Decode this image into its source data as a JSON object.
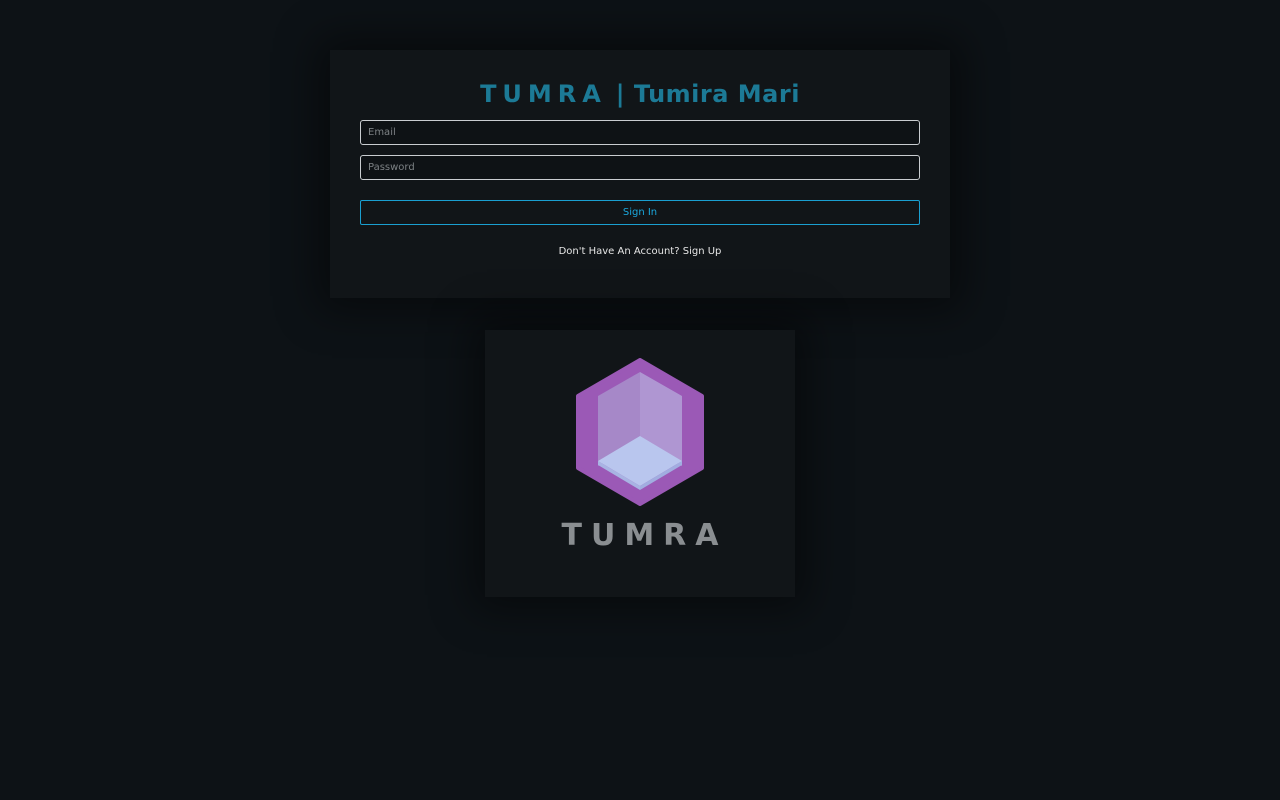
{
  "login": {
    "title_brand": "TUMRA",
    "title_separator": " | ",
    "title_name": "Tumira Mari",
    "email": {
      "placeholder": "Email",
      "value": ""
    },
    "password": {
      "placeholder": "Password",
      "value": ""
    },
    "signin_label": "Sign In",
    "signup_prompt": "Don't Have An Account?",
    "signup_link": "Sign Up"
  },
  "logo": {
    "text": "TUMRA",
    "icon": "hexagon-cube-icon",
    "colors": {
      "hex_outer": "#9b59b6",
      "cube_face": "#b8a6d8",
      "cube_floor": "#b4c4ec",
      "text": "#8a8e91"
    }
  },
  "colors": {
    "background": "#0d1216",
    "card": "#111518",
    "title": "#1c7a96",
    "accent": "#1aa7dc"
  }
}
